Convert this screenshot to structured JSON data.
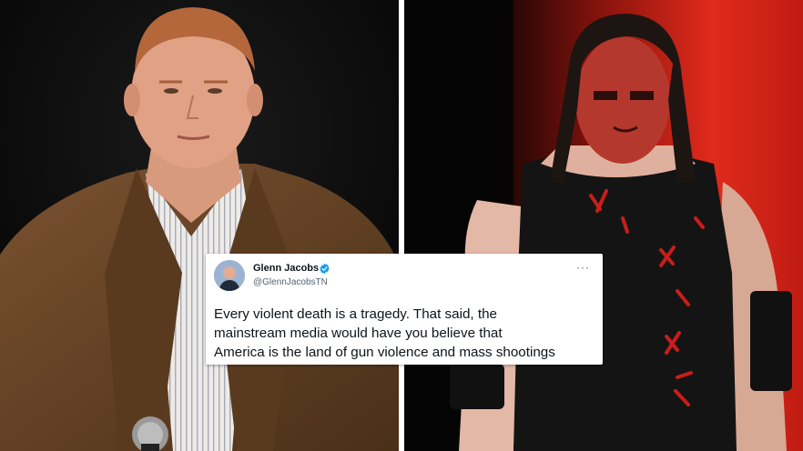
{
  "tweet": {
    "display_name": "Glenn Jacobs",
    "handle": "@GlennJacobsTN",
    "more_icon": "more-dots-icon",
    "verified_icon": "verified-badge-icon",
    "verified_color": "#1d9bf0",
    "text_lines": [
      "Every violent death is a tragedy. That said, the",
      "mainstream media would have you believe that",
      "America is the land of gun violence and mass shootings"
    ]
  },
  "colors": {
    "stage_red": "#d8231b",
    "divider": "#ffffff"
  }
}
